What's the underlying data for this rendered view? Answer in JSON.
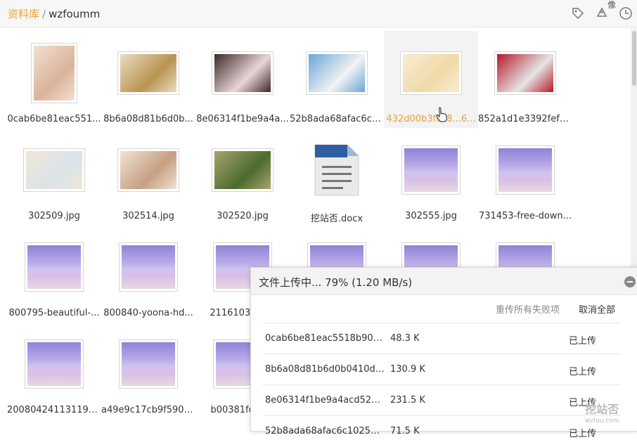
{
  "breadcrumb": {
    "root": "资料库",
    "separator": "/",
    "current": "wzfoumm"
  },
  "toolbar": {
    "icons": [
      "tag-icon",
      "recycle-icon",
      "history-icon"
    ],
    "partial_label": "像"
  },
  "files": [
    {
      "name": "0cab6be81eac551...",
      "kind": "photo",
      "palette": [
        "#d9b39a",
        "#f2e1d3"
      ]
    },
    {
      "name": "8b6a08d81b6d0b...",
      "kind": "photo",
      "palette": [
        "#b9934f",
        "#e9dcc2"
      ]
    },
    {
      "name": "8e06314f1be9a4a...",
      "kind": "photo",
      "palette": [
        "#e9d6d9",
        "#3b2a27"
      ]
    },
    {
      "name": "52b8ada68afac6c1...",
      "kind": "photo",
      "palette": [
        "#f2f2f4",
        "#6aa6d8"
      ]
    },
    {
      "name": "432d00b3fca8...6...",
      "kind": "photo",
      "palette": [
        "#efd9a8",
        "#f8ecd2"
      ],
      "hover": true
    },
    {
      "name": "852a1d1e3392fefa...",
      "kind": "photo",
      "palette": [
        "#e5e5e5",
        "#b5192b"
      ]
    },
    {
      "name": "302509.jpg",
      "kind": "photo",
      "palette": [
        "#d9e4e8",
        "#f1e6d6"
      ]
    },
    {
      "name": "302514.jpg",
      "kind": "photo",
      "palette": [
        "#c79f82",
        "#efe3d5"
      ]
    },
    {
      "name": "302520.jpg",
      "kind": "photo",
      "palette": [
        "#4b6b2f",
        "#a9a46b"
      ]
    },
    {
      "name": "挖站否.docx",
      "kind": "doc",
      "palette": [
        "#2f5f9e",
        "#e8e8e8"
      ]
    },
    {
      "name": "302555.jpg",
      "kind": "sea",
      "palette": [
        "#8f83d6",
        "#d8bfe6"
      ]
    },
    {
      "name": "731453-free-down...",
      "kind": "sea",
      "palette": [
        "#8f83d6",
        "#d8bfe6"
      ]
    },
    {
      "name": "800795-beautiful-...",
      "kind": "sea",
      "palette": [
        "#8f83d6",
        "#d8bfe6"
      ]
    },
    {
      "name": "800840-yoona-hd...",
      "kind": "sea",
      "palette": [
        "#8f83d6",
        "#d8bfe6"
      ]
    },
    {
      "name": "21161039_1...",
      "kind": "sea",
      "palette": [
        "#8f83d6",
        "#d8bfe6"
      ]
    },
    {
      "name": "",
      "kind": "sea",
      "palette": [
        "#8f83d6",
        "#d8bfe6"
      ]
    },
    {
      "name": "",
      "kind": "sea",
      "palette": [
        "#8f83d6",
        "#d8bfe6"
      ]
    },
    {
      "name": "",
      "kind": "sea",
      "palette": [
        "#8f83d6",
        "#d8bfe6"
      ]
    },
    {
      "name": "200804241131191...",
      "kind": "sea",
      "palette": [
        "#8f83d6",
        "#d8bfe6"
      ]
    },
    {
      "name": "a49e9c17cb9f5902...",
      "kind": "sea",
      "palette": [
        "#8f83d6",
        "#d8bfe6"
      ]
    },
    {
      "name": "b00381fd5a...",
      "kind": "sea",
      "palette": [
        "#8f83d6",
        "#d8bfe6"
      ]
    }
  ],
  "upload_panel": {
    "title": "文件上传中... 79% (1.20 MB/s)",
    "progress_percent": 79,
    "retry_all_failed": "重传所有失败项",
    "cancel_all": "取消全部",
    "rows": [
      {
        "name": "0cab6be81eac5518b90e2...",
        "size": "48.3 K",
        "status": "已上传"
      },
      {
        "name": "8b6a08d81b6d0b0410df9...",
        "size": "130.9 K",
        "status": "已上传"
      },
      {
        "name": "8e06314f1be9a4acd52afc...",
        "size": "231.5 K",
        "status": "已上传"
      },
      {
        "name": "52b8ada68afac6c10252...",
        "size": "71.5 K",
        "status": "已上传"
      }
    ]
  },
  "watermark": {
    "text": "挖站否",
    "sub": "wzfou.com"
  },
  "colors": {
    "accent": "#e6a23c",
    "panel_header": "#f3f3f3"
  }
}
